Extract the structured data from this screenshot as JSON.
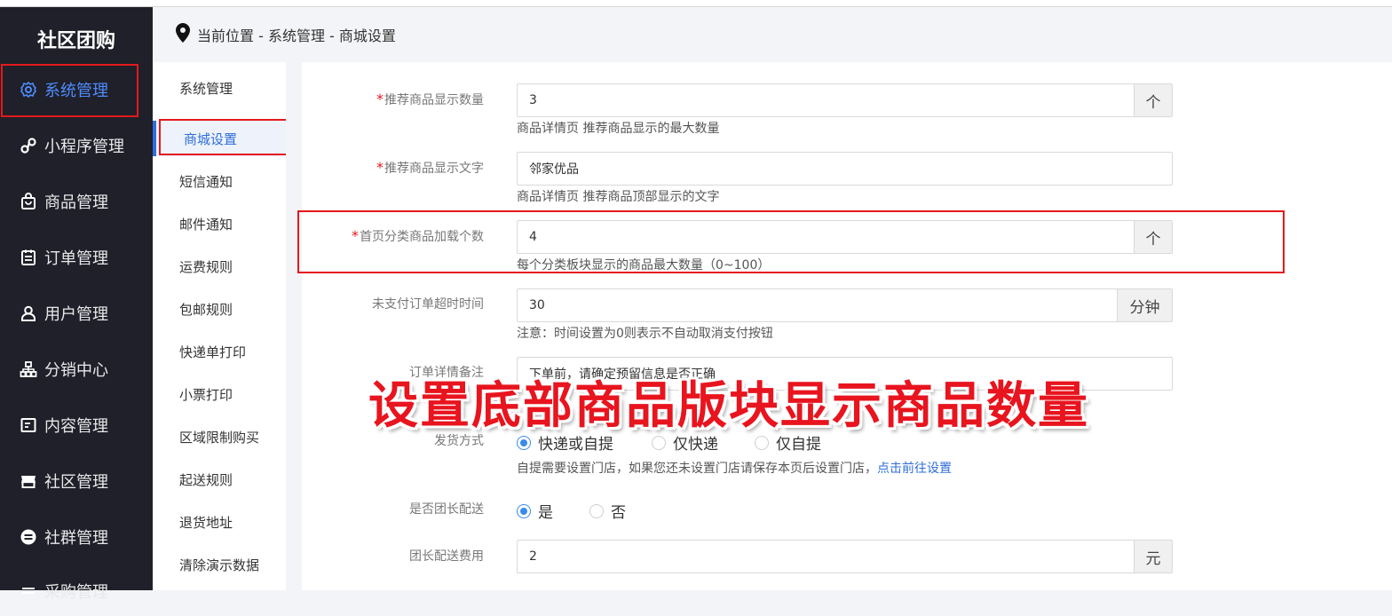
{
  "sidebar": {
    "brand": "社区团购",
    "items": [
      {
        "label": "系统管理",
        "icon": "gear-icon"
      },
      {
        "label": "小程序管理",
        "icon": "link-icon"
      },
      {
        "label": "商品管理",
        "icon": "bag-icon"
      },
      {
        "label": "订单管理",
        "icon": "clipboard-icon"
      },
      {
        "label": "用户管理",
        "icon": "user-icon"
      },
      {
        "label": "分销中心",
        "icon": "hierarchy-icon"
      },
      {
        "label": "内容管理",
        "icon": "document-icon"
      },
      {
        "label": "社区管理",
        "icon": "store-icon"
      },
      {
        "label": "社群管理",
        "icon": "group-icon"
      },
      {
        "label": "采购管理",
        "icon": "cart-icon"
      }
    ]
  },
  "header": {
    "breadcrumb": "当前位置 - 系统管理 - 商城设置"
  },
  "submenu": {
    "items": [
      "系统管理",
      "商城设置",
      "短信通知",
      "邮件通知",
      "运费规则",
      "包邮规则",
      "快递单打印",
      "小票打印",
      "区域限制购买",
      "起送规则",
      "退货地址",
      "清除演示数据"
    ]
  },
  "form": {
    "rec_count": {
      "label": "推荐商品显示数量",
      "value": "3",
      "unit": "个",
      "help": "商品详情页 推荐商品显示的最大数量"
    },
    "rec_text": {
      "label": "推荐商品显示文字",
      "value": "邻家优品",
      "help": "商品详情页 推荐商品顶部显示的文字"
    },
    "cat_count": {
      "label": "首页分类商品加载个数",
      "value": "4",
      "unit": "个",
      "help": "每个分类板块显示的商品最大数量（0~100）"
    },
    "timeout": {
      "label": "未支付订单超时时间",
      "value": "30",
      "unit": "分钟",
      "help": "注意：时间设置为0则表示不自动取消支付按钮"
    },
    "remark": {
      "label": "订单详情备注",
      "value": "下单前，请确定预留信息是否正确"
    },
    "ship": {
      "label": "发货方式",
      "options": [
        "快递或自提",
        "仅快递",
        "仅自提"
      ],
      "help": "自提需要设置门店，如果您还未设置门店请保存本页后设置门店，",
      "help_link": "点击前往设置"
    },
    "leader": {
      "label": "是否团长配送",
      "options": [
        "是",
        "否"
      ]
    },
    "leader_fee": {
      "label": "团长配送费用",
      "value": "2",
      "unit": "元"
    }
  },
  "overlay_text": "设置底部商品版块显示商品数量",
  "colors": {
    "sidebar_bg": "#1f2029",
    "accent": "#2f6ed9",
    "highlight": "#e5191d",
    "radio_on": "#3a8be8"
  }
}
